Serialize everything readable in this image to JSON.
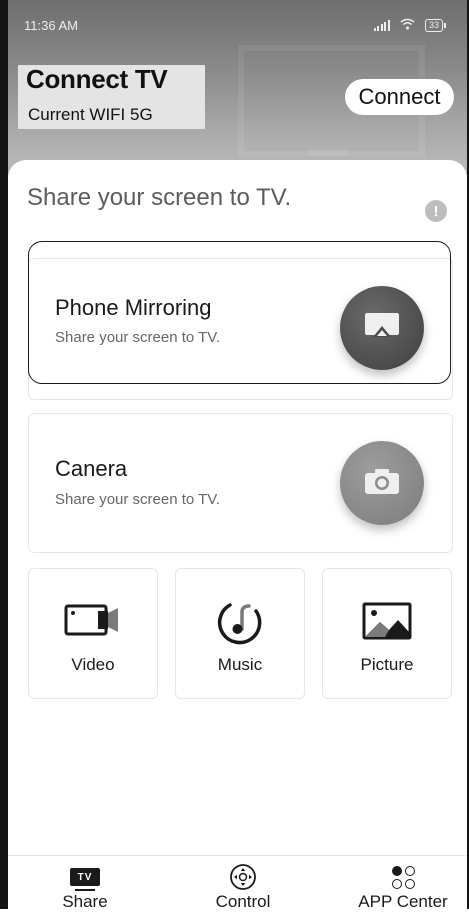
{
  "status_bar": {
    "time": "11:36 AM",
    "battery": "33"
  },
  "header": {
    "title": "Connect TV",
    "wifi": "Current WIFI 5G",
    "connect_label": "Connect"
  },
  "main": {
    "heading": "Share your screen to TV.",
    "cards": [
      {
        "title": "Phone Mirroring",
        "subtitle": "Share your screen to TV.",
        "icon": "cast-screen-icon"
      },
      {
        "title": "Canera",
        "subtitle": "Share your screen to TV.",
        "icon": "camera-icon"
      }
    ],
    "tiles": [
      {
        "label": "Video",
        "icon": "video-camera-icon"
      },
      {
        "label": "Music",
        "icon": "music-note-icon"
      },
      {
        "label": "Picture",
        "icon": "image-icon"
      }
    ]
  },
  "bottom_nav": {
    "items": [
      {
        "label": "Share",
        "icon": "tv-icon",
        "active": true
      },
      {
        "label": "Control",
        "icon": "remote-control-icon",
        "active": false
      },
      {
        "label": "APP Center",
        "icon": "app-grid-icon",
        "active": false
      }
    ],
    "share_badge": "TV"
  },
  "colors": {
    "header_top": "#6e6e6e",
    "header_bottom": "#c6c6c6",
    "text": "#1a1a1a",
    "subtle_text": "#666666"
  }
}
